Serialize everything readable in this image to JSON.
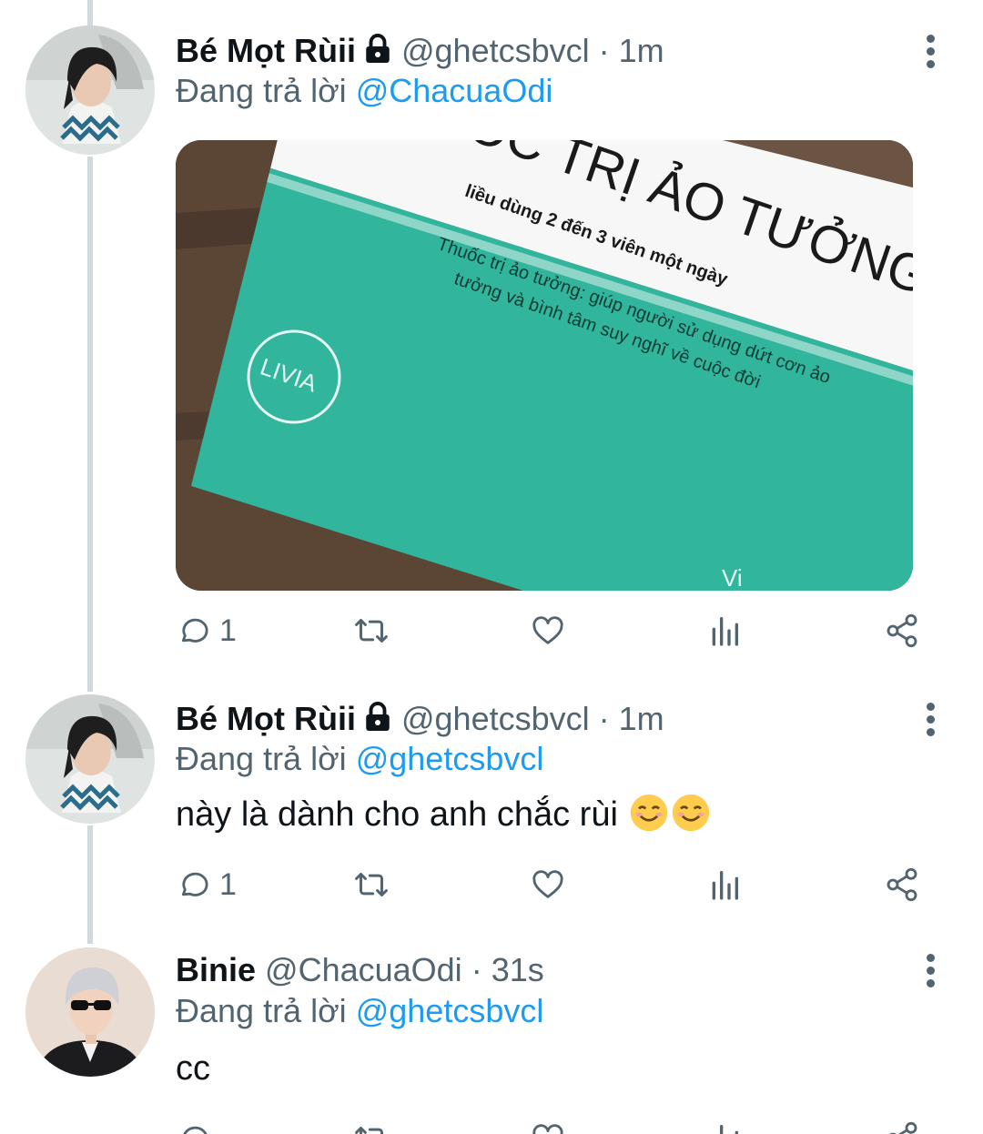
{
  "tweets": [
    {
      "display_name": "Bé Mọt Rùii",
      "handle": "@ghetcsbvcl",
      "time": "· 1m",
      "reply_prefix": "Đang trả lời",
      "reply_to": "@ChacuaOdi",
      "locked": true,
      "text": "",
      "media": {
        "title": "THUỐC TRỊ ẢO TƯỞNG",
        "dosage": "liều dùng 2 đến 3 viên một ngày",
        "brand": "LIVIA",
        "desc_line1": "Thuốc trị ảo tưởng: giúp người sử dụng dứt cơn ảo",
        "desc_line2": "tưởng và bình tâm suy nghĩ về cuộc đời",
        "corner": "Vi"
      },
      "reply_count": "1"
    },
    {
      "display_name": "Bé Mọt Rùii",
      "handle": "@ghetcsbvcl",
      "time": "· 1m",
      "reply_prefix": "Đang trả lời",
      "reply_to": "@ghetcsbvcl",
      "locked": true,
      "text": "này là dành cho anh chắc rùi",
      "emojis": [
        "smiling-face-emoji",
        "smiling-face-emoji"
      ],
      "reply_count": "1"
    },
    {
      "display_name": "Binie",
      "handle": "@ChacuaOdi",
      "time": "· 31s",
      "reply_prefix": "Đang trả lời",
      "reply_to": "@ghetcsbvcl",
      "locked": false,
      "text": "cc",
      "reply_count": ""
    }
  ],
  "colors": {
    "text_primary": "#0f1419",
    "text_secondary": "#536471",
    "accent": "#1d9bf0",
    "thread_line": "#cfd9de"
  },
  "icons": [
    "reply-icon",
    "retweet-icon",
    "like-icon",
    "analytics-icon",
    "share-icon",
    "more-icon",
    "lock-icon"
  ]
}
